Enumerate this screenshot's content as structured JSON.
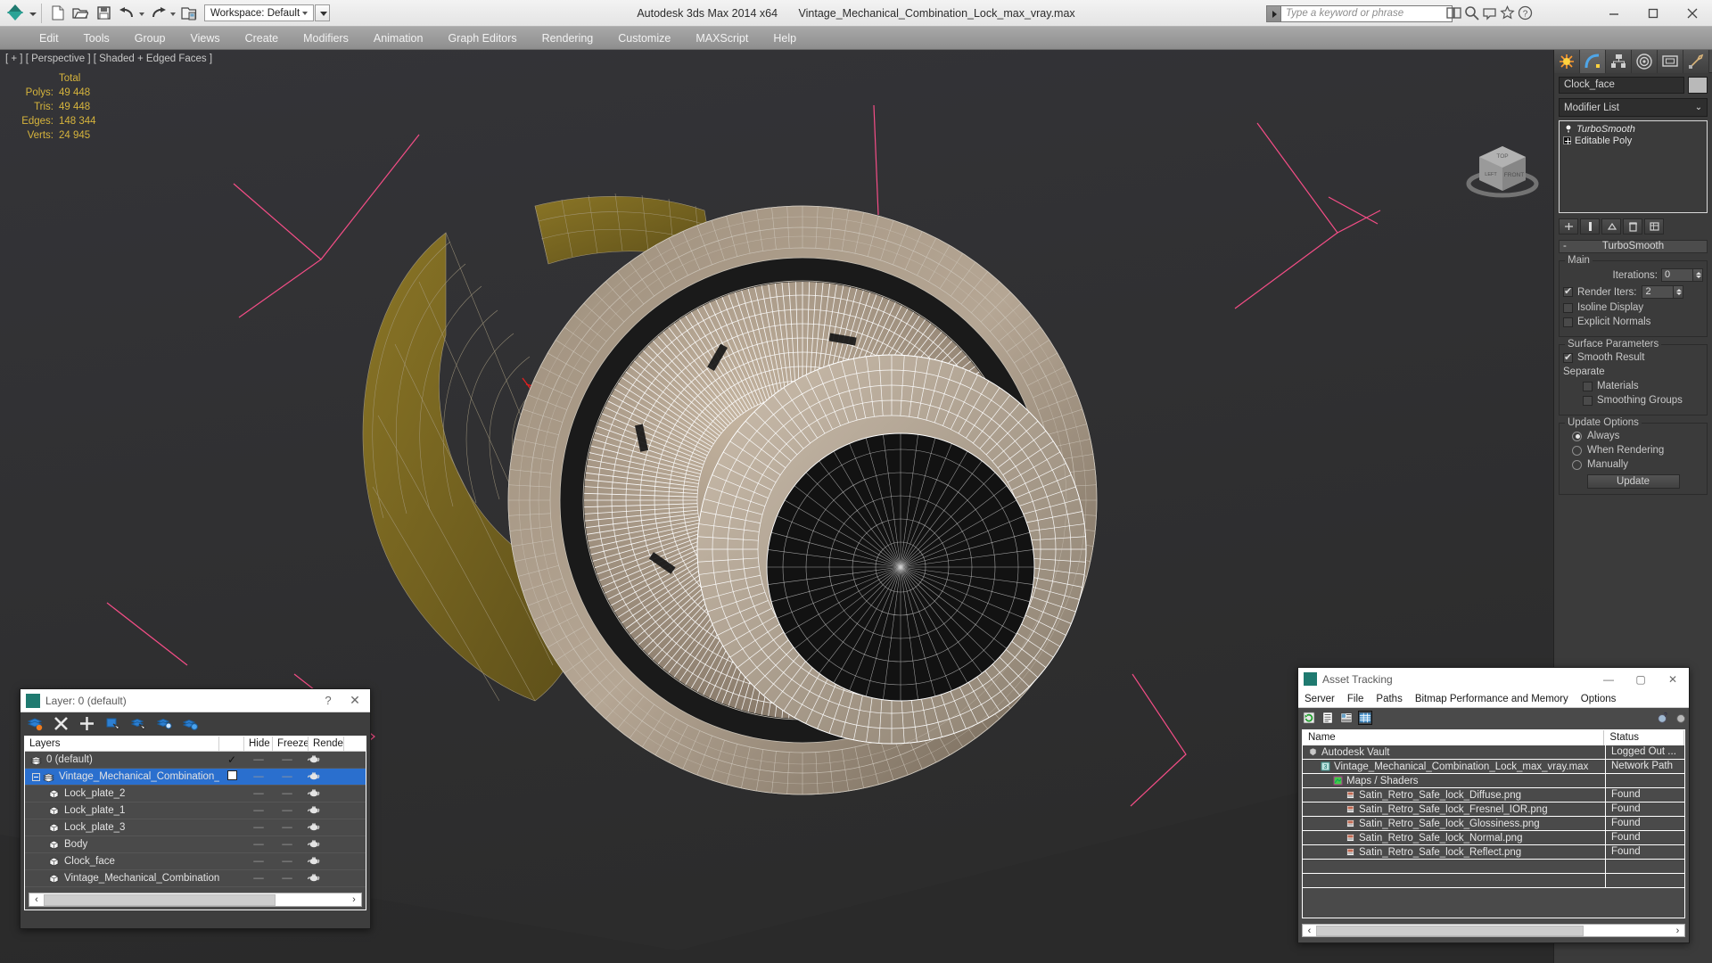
{
  "app": {
    "title": "Autodesk 3ds Max  2014 x64",
    "document": "Vintage_Mechanical_Combination_Lock_max_vray.max",
    "workspace": "Workspace: Default"
  },
  "quick_access": [
    {
      "name": "new-file-icon",
      "label": "New"
    },
    {
      "name": "open-file-icon",
      "label": "Open"
    },
    {
      "name": "save-file-icon",
      "label": "Save"
    },
    {
      "name": "undo-icon",
      "label": "Undo"
    },
    {
      "name": "redo-icon",
      "label": "Redo"
    },
    {
      "name": "project-folder-icon",
      "label": "Set Project Folder"
    }
  ],
  "search": {
    "placeholder": "Type a keyword or phrase"
  },
  "menu": [
    "Edit",
    "Tools",
    "Group",
    "Views",
    "Create",
    "Modifiers",
    "Animation",
    "Graph Editors",
    "Rendering",
    "Customize",
    "MAXScript",
    "Help"
  ],
  "window_controls": [
    "minimize",
    "maximize",
    "close"
  ],
  "viewport": {
    "label": "[ + ] [ Perspective ] [ Shaded + Edged Faces ]",
    "stats": {
      "header": "Total",
      "rows": [
        {
          "label": "Polys:",
          "value": "49 448"
        },
        {
          "label": "Tris:",
          "value": "49 448"
        },
        {
          "label": "Edges:",
          "value": "148 344"
        },
        {
          "label": "Verts:",
          "value": "24 945"
        }
      ]
    },
    "viewcube_faces": [
      "TOP",
      "FRONT",
      "LEFT"
    ],
    "colors": {
      "background": "#303030",
      "mesh_light": "#b0a18f",
      "mesh_dark": "#8e7f6c",
      "mesh_olive": "#7d6b25",
      "wire_white": "#ffffff",
      "wire_gray": "#a9a49b",
      "helper_pink": "#ff4f8b",
      "helper_red": "#e02020"
    }
  },
  "command_panel": {
    "tabs": [
      "create-tab",
      "modify-tab",
      "hierarchy-tab",
      "motion-tab",
      "display-tab",
      "utilities-tab"
    ],
    "active_tab": "modify-tab",
    "object_name": "Clock_face",
    "modifier_list_label": "Modifier List",
    "stack": [
      {
        "label": "TurboSmooth",
        "italic": true
      },
      {
        "label": "Editable Poly",
        "italic": false
      }
    ],
    "rollout": {
      "title": "TurboSmooth",
      "main_group": "Main",
      "iterations_label": "Iterations:",
      "iterations_value": "0",
      "render_iters_label": "Render Iters:",
      "render_iters_value": "2",
      "render_iters_checked": true,
      "isoline_label": "Isoline Display",
      "isoline_checked": false,
      "explicit_normals_label": "Explicit Normals",
      "explicit_normals_checked": false,
      "surface_group": "Surface Parameters",
      "smooth_result_label": "Smooth Result",
      "smooth_result_checked": true,
      "separate_label": "Separate",
      "materials_label": "Materials",
      "materials_checked": false,
      "smoothing_groups_label": "Smoothing Groups",
      "smoothing_groups_checked": false,
      "update_group": "Update Options",
      "update_options": [
        {
          "label": "Always",
          "selected": true
        },
        {
          "label": "When Rendering",
          "selected": false
        },
        {
          "label": "Manually",
          "selected": false
        }
      ],
      "update_button": "Update"
    }
  },
  "layers_dialog": {
    "title": "Layer: 0 (default)",
    "help_glyph": "?",
    "close_glyph": "✕",
    "toolbar": [
      "new-layer-icon",
      "delete-layer-icon",
      "add-layer-icon",
      "select-objects-icon",
      "select-highlighted-icon",
      "highlight-selected-icon",
      "layer-properties-icon"
    ],
    "columns": [
      "Layers",
      "",
      "Hide",
      "Freeze",
      "Rende"
    ],
    "rows": [
      {
        "name": "0 (default)",
        "indent": 0,
        "type": "layer",
        "expand": false,
        "current": "✓",
        "selected": false
      },
      {
        "name": "Vintage_Mechanical_Combination_Lock",
        "indent": 0,
        "type": "layer",
        "expand": true,
        "current": "box",
        "selected": true
      },
      {
        "name": "Lock_plate_2",
        "indent": 1,
        "type": "object",
        "expand": false,
        "current": "",
        "selected": false
      },
      {
        "name": "Lock_plate_1",
        "indent": 1,
        "type": "object",
        "expand": false,
        "current": "",
        "selected": false
      },
      {
        "name": "Lock_plate_3",
        "indent": 1,
        "type": "object",
        "expand": false,
        "current": "",
        "selected": false
      },
      {
        "name": "Body",
        "indent": 1,
        "type": "object",
        "expand": false,
        "current": "",
        "selected": false
      },
      {
        "name": "Clock_face",
        "indent": 1,
        "type": "object",
        "expand": false,
        "current": "",
        "selected": false
      },
      {
        "name": "Vintage_Mechanical_Combination_Lock",
        "indent": 1,
        "type": "object",
        "expand": false,
        "current": "",
        "selected": false
      }
    ],
    "scroll_left": "‹",
    "scroll_right": "›"
  },
  "asset_tracking": {
    "title": "Asset Tracking",
    "window_controls": {
      "minimize": "—",
      "maximize": "▢",
      "close": "✕"
    },
    "menu": [
      "Server",
      "File",
      "Paths",
      "Bitmap Performance and Memory",
      "Options"
    ],
    "toolbar": [
      "refresh-icon",
      "list-view-icon",
      "detail-view-icon",
      "grid-view-icon"
    ],
    "toolbar_right": [
      "vault-help-icon",
      "vault-about-icon"
    ],
    "columns": [
      "Name",
      "Status"
    ],
    "rows": [
      {
        "name": "Autodesk Vault",
        "status": "Logged Out ...",
        "indent": 0,
        "icon": "vault-icon"
      },
      {
        "name": "Vintage_Mechanical_Combination_Lock_max_vray.max",
        "status": "Network Path",
        "indent": 1,
        "icon": "max-file-icon"
      },
      {
        "name": "Maps / Shaders",
        "status": "",
        "indent": 2,
        "icon": "maps-icon"
      },
      {
        "name": "Satin_Retro_Safe_lock_Diffuse.png",
        "status": "Found",
        "indent": 3,
        "icon": "bitmap-icon"
      },
      {
        "name": "Satin_Retro_Safe_lock_Fresnel_IOR.png",
        "status": "Found",
        "indent": 3,
        "icon": "bitmap-icon"
      },
      {
        "name": "Satin_Retro_Safe_lock_Glossiness.png",
        "status": "Found",
        "indent": 3,
        "icon": "bitmap-icon"
      },
      {
        "name": "Satin_Retro_Safe_lock_Normal.png",
        "status": "Found",
        "indent": 3,
        "icon": "bitmap-icon"
      },
      {
        "name": "Satin_Retro_Safe_lock_Reflect.png",
        "status": "Found",
        "indent": 3,
        "icon": "bitmap-icon"
      },
      {
        "name": "",
        "status": "",
        "indent": 0,
        "icon": ""
      },
      {
        "name": "",
        "status": "",
        "indent": 0,
        "icon": ""
      }
    ],
    "scroll_left": "‹",
    "scroll_right": "›"
  }
}
